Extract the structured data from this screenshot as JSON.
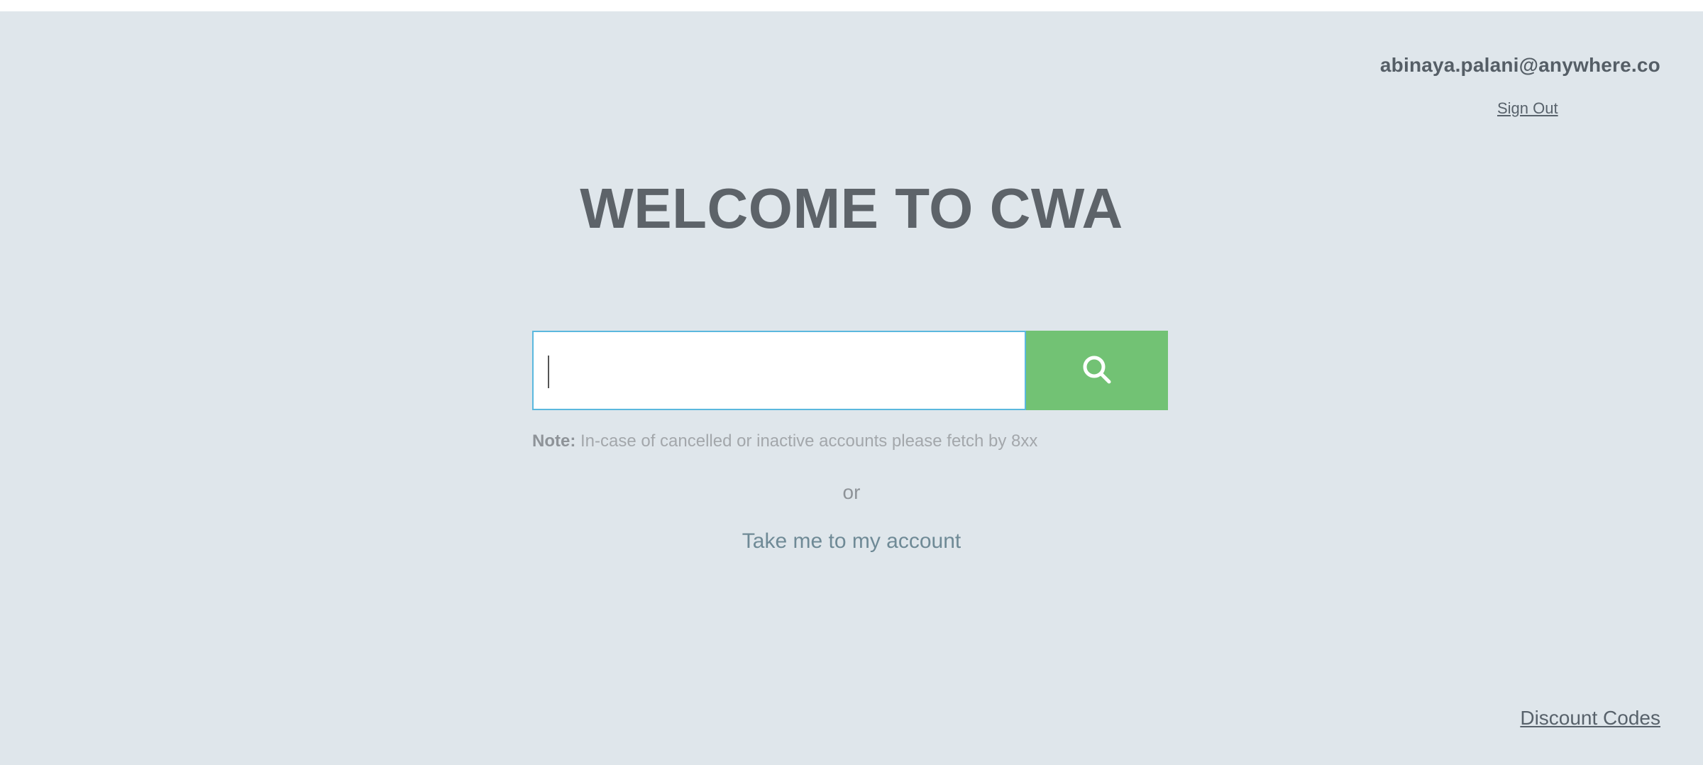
{
  "header": {
    "user_email": "abinaya.palani@anywhere.co",
    "sign_out_label": "Sign Out"
  },
  "main": {
    "title": "WELCOME TO CWA",
    "search": {
      "value": "",
      "placeholder": "",
      "button_icon": "search-icon"
    },
    "note_label": "Note:",
    "note_text": " In-case of cancelled or inactive accounts please fetch by 8xx",
    "or_text": "or",
    "account_link_label": "Take me to my account"
  },
  "footer": {
    "discount_codes_label": "Discount Codes"
  },
  "colors": {
    "background": "#dfe6eb",
    "accent_green": "#72c274",
    "input_border": "#5bb8de"
  }
}
